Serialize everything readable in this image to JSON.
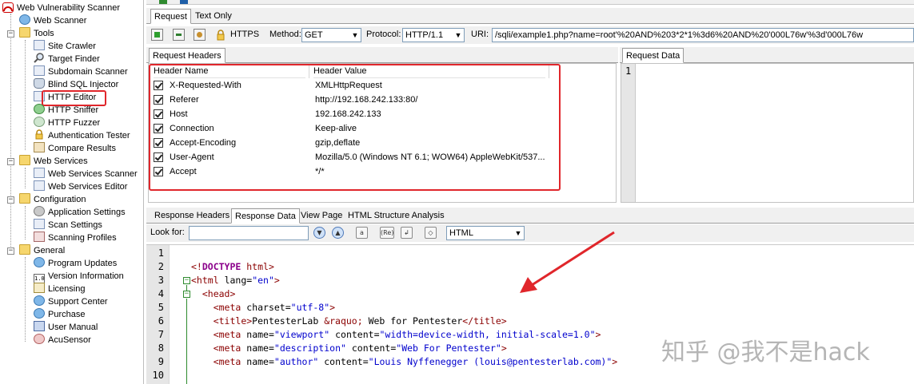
{
  "tree": {
    "root": "Web Vulnerability Scanner",
    "items": [
      {
        "label": "Web Scanner",
        "icon": "web-scanner-icon"
      },
      {
        "label": "Tools",
        "icon": "folder-icon"
      },
      {
        "label": "Site Crawler",
        "icon": "site-crawler-icon"
      },
      {
        "label": "Target Finder",
        "icon": "target-finder-icon"
      },
      {
        "label": "Subdomain Scanner",
        "icon": "subdomain-scanner-icon"
      },
      {
        "label": "Blind SQL Injector",
        "icon": "blind-sql-icon"
      },
      {
        "label": "HTTP Editor",
        "icon": "http-editor-icon"
      },
      {
        "label": "HTTP Sniffer",
        "icon": "http-sniffer-icon"
      },
      {
        "label": "HTTP Fuzzer",
        "icon": "http-fuzzer-icon"
      },
      {
        "label": "Authentication Tester",
        "icon": "lock-icon"
      },
      {
        "label": "Compare Results",
        "icon": "compare-icon"
      },
      {
        "label": "Web Services",
        "icon": "folder-icon"
      },
      {
        "label": "Web Services Scanner",
        "icon": "ws-scanner-icon"
      },
      {
        "label": "Web Services Editor",
        "icon": "ws-editor-icon"
      },
      {
        "label": "Configuration",
        "icon": "folder-icon"
      },
      {
        "label": "Application Settings",
        "icon": "settings-icon"
      },
      {
        "label": "Scan Settings",
        "icon": "scan-settings-icon"
      },
      {
        "label": "Scanning Profiles",
        "icon": "profiles-icon"
      },
      {
        "label": "General",
        "icon": "folder-icon"
      },
      {
        "label": "Program Updates",
        "icon": "updates-icon"
      },
      {
        "label": "Version Information",
        "icon": "version-icon"
      },
      {
        "label": "Licensing",
        "icon": "licensing-icon"
      },
      {
        "label": "Support Center",
        "icon": "support-icon"
      },
      {
        "label": "Purchase",
        "icon": "purchase-icon"
      },
      {
        "label": "User Manual",
        "icon": "manual-icon"
      },
      {
        "label": "AcuSensor",
        "icon": "acusensor-icon"
      }
    ],
    "version_badge": "1.0"
  },
  "request_tabs": [
    "Request",
    "Text Only"
  ],
  "toolbar": {
    "https_label": "HTTPS",
    "method_label": "Method:",
    "method_value": "GET",
    "protocol_label": "Protocol:",
    "protocol_value": "HTTP/1.1",
    "uri_label": "URI:",
    "uri_value": "/sqli/example1.php?name=root'%20AND%203*2*1%3d6%20AND%20'000L76w'%3d'000L76w"
  },
  "request_headers": {
    "tab": "Request Headers",
    "col_name": "Header Name",
    "col_value": "Header Value",
    "rows": [
      {
        "name": "X-Requested-With",
        "value": "XMLHttpRequest"
      },
      {
        "name": "Referer",
        "value": "http://192.168.242.133:80/"
      },
      {
        "name": "Host",
        "value": "192.168.242.133"
      },
      {
        "name": "Connection",
        "value": "Keep-alive"
      },
      {
        "name": "Accept-Encoding",
        "value": "gzip,deflate"
      },
      {
        "name": "User-Agent",
        "value": "Mozilla/5.0 (Windows NT 6.1; WOW64) AppleWebKit/537..."
      },
      {
        "name": "Accept",
        "value": "*/*"
      }
    ]
  },
  "request_data": {
    "tab": "Request Data",
    "line": "1"
  },
  "response_tabs": [
    "Response Headers",
    "Response Data",
    "View Page",
    "HTML Structure Analysis"
  ],
  "lookfor": {
    "label": "Look for:",
    "value": "",
    "format_value": "HTML",
    "regex_label": "(Re)"
  },
  "editor": {
    "line_numbers": [
      "1",
      "2",
      "3",
      "4",
      "5",
      "6",
      "7",
      "8",
      "9",
      "10"
    ]
  },
  "watermark": "知乎 @我不是hack",
  "colors": {
    "highlight": "#e0262b",
    "selection": "#316ac5",
    "tag": "#8b0000",
    "string": "#0000cd"
  }
}
